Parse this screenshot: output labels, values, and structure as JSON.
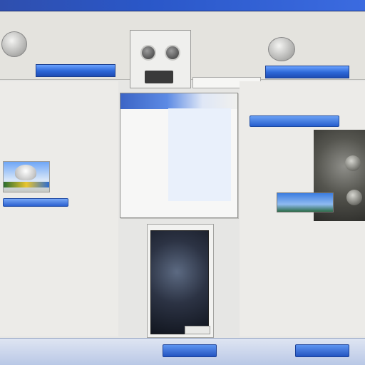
{
  "colors": {
    "accent_blue": "#2c66d6",
    "link_blue": "#2a56b8",
    "highlight_red": "#c0432e",
    "background": "#e6e6e4"
  },
  "header": {
    "text_lines": [
      "",
      "",
      "",
      ""
    ],
    "blue_bar_left": "",
    "blue_bar_right": "",
    "search_placeholder": "",
    "icons": [
      "device-icon",
      "camera-icon",
      "scanner-icon"
    ]
  },
  "left": {
    "lines": [
      "",
      "",
      "",
      "",
      "",
      "",
      "",
      "",
      "",
      "",
      "",
      "",
      "",
      ""
    ],
    "button_label": ""
  },
  "center_window": {
    "title": "",
    "rows": [
      {
        "label": "",
        "value": ""
      },
      {
        "label": "",
        "value": ""
      },
      {
        "label": "",
        "value": ""
      },
      {
        "label": "",
        "value": ""
      },
      {
        "label": "",
        "value": ""
      },
      {
        "label": "",
        "value": ""
      },
      {
        "label": "",
        "value": ""
      },
      {
        "label": "",
        "value": ""
      },
      {
        "label": "",
        "value": ""
      },
      {
        "label": "",
        "value": ""
      },
      {
        "label": "",
        "value": ""
      },
      {
        "label": "",
        "value": ""
      },
      {
        "label": "",
        "value": ""
      },
      {
        "label": "",
        "value": ""
      }
    ]
  },
  "right": {
    "lines": [
      "",
      "",
      "",
      "",
      "",
      "",
      "",
      "",
      ""
    ],
    "button_label": ""
  },
  "footer": {
    "buttons": [
      "",
      ""
    ]
  }
}
